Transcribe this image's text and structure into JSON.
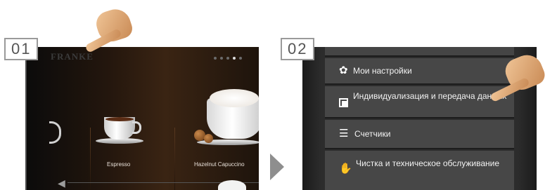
{
  "steps": {
    "step1": "01",
    "step2": "02"
  },
  "screen1": {
    "brand": "FRANKE",
    "page_dots": {
      "count": 5,
      "active": 4
    },
    "products": [
      "Espresso",
      "Hazelnut Capuccino"
    ]
  },
  "menu": {
    "items": [
      {
        "icon": "gear-icon",
        "label": "Мои настройки"
      },
      {
        "icon": "copy-transfer-icon",
        "label": "Индивидуализация и передача данных"
      },
      {
        "icon": "list-icon",
        "label": "Счетчики"
      },
      {
        "icon": "cleaning-icon",
        "label": "Чистка и техническое обслуживание"
      }
    ]
  },
  "colors": {
    "menu_item_bg": "#474747",
    "screen_bg": "#2c2c2c",
    "label_border": "#9a9a9a"
  }
}
